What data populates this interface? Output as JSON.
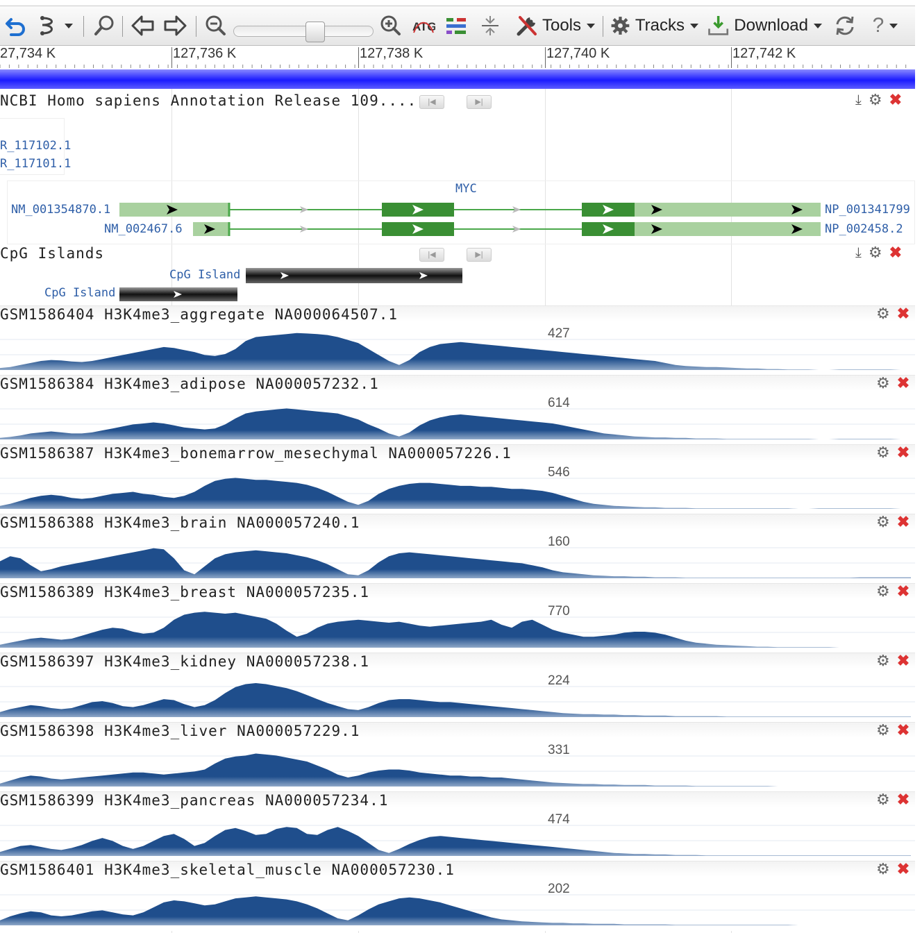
{
  "toolbar": {
    "tools_label": "Tools",
    "tracks_label": "Tracks",
    "download_label": "Download",
    "items": [
      {
        "icon": "undo-icon"
      },
      {
        "icon": "tracks-menu-icon"
      },
      {
        "icon": "find-icon"
      },
      {
        "icon": "pan-left-icon"
      },
      {
        "icon": "pan-right-icon"
      },
      {
        "icon": "zoom-out-icon"
      },
      {
        "icon": "zoom-in-icon"
      },
      {
        "icon": "sequence-view-icon"
      },
      {
        "icon": "color-key-icon"
      },
      {
        "icon": "collapse-icon"
      },
      {
        "icon": "tools-icon"
      },
      {
        "icon": "tracks-gear-icon"
      },
      {
        "icon": "download-icon"
      },
      {
        "icon": "reload-icon"
      },
      {
        "icon": "help-icon"
      }
    ],
    "zoom_slider_value": 0.55
  },
  "ruler": {
    "labels": [
      "27,734 K",
      "127,736 K",
      "127,738 K",
      "127,740 K",
      "127,742 K"
    ]
  },
  "annotation_track": {
    "title": "NCBI Homo sapiens Annotation Release 109....",
    "left_labels": [
      "R_117102.1",
      "R_117101.1"
    ],
    "gene_name": "MYC",
    "transcripts": [
      {
        "name": "NM_001354870.1",
        "protein": "NP_001341799"
      },
      {
        "name": "NM_002467.6",
        "protein": "NP_002458.2"
      }
    ]
  },
  "cpg_track": {
    "title": "CpG Islands",
    "features": [
      {
        "label": "CpG Island"
      },
      {
        "label": "CpG Island"
      }
    ]
  },
  "graph_tracks": [
    {
      "title": "GSM1586404 H3K4me3_aggregate NA000064507.1",
      "max": "427",
      "profile": [
        4,
        6,
        10,
        14,
        18,
        20,
        19,
        17,
        16,
        18,
        22,
        26,
        30,
        34,
        38,
        42,
        46,
        44,
        40,
        36,
        30,
        28,
        32,
        42,
        58,
        66,
        68,
        70,
        72,
        74,
        73,
        72,
        70,
        66,
        60,
        54,
        42,
        30,
        18,
        10,
        20,
        36,
        46,
        52,
        54,
        56,
        54,
        52,
        50,
        48,
        46,
        44,
        42,
        40,
        38,
        36,
        34,
        32,
        30,
        28,
        26,
        24,
        22,
        20,
        18,
        14,
        10,
        8,
        7,
        6,
        6,
        5,
        4,
        3,
        3,
        2,
        2,
        1,
        1,
        1,
        0,
        0,
        1,
        1,
        1,
        1,
        1,
        1,
        0,
        0
      ]
    },
    {
      "title": "GSM1586384 H3K4me3_adipose NA000057232.1",
      "max": "614",
      "profile": [
        3,
        5,
        8,
        12,
        14,
        16,
        14,
        12,
        12,
        14,
        18,
        22,
        26,
        30,
        32,
        34,
        32,
        28,
        24,
        22,
        20,
        22,
        30,
        42,
        52,
        56,
        58,
        60,
        62,
        60,
        58,
        56,
        54,
        52,
        46,
        40,
        30,
        22,
        12,
        6,
        14,
        28,
        38,
        44,
        48,
        50,
        48,
        46,
        44,
        42,
        40,
        38,
        36,
        34,
        32,
        28,
        24,
        20,
        16,
        12,
        10,
        8,
        6,
        5,
        4,
        4,
        3,
        3,
        2,
        2,
        2,
        1,
        1,
        1,
        1,
        1,
        1,
        1,
        1,
        1,
        0,
        0,
        1,
        1,
        1,
        1,
        1,
        1,
        0,
        0
      ]
    },
    {
      "title": "GSM1586387 H3K4me3_bonemarrow_mesechymal NA000057226.1",
      "max": "546",
      "profile": [
        6,
        10,
        16,
        22,
        26,
        28,
        26,
        22,
        20,
        22,
        26,
        30,
        32,
        34,
        30,
        28,
        24,
        22,
        26,
        34,
        46,
        56,
        60,
        62,
        60,
        58,
        58,
        56,
        54,
        52,
        48,
        42,
        34,
        24,
        14,
        8,
        16,
        30,
        40,
        46,
        50,
        52,
        52,
        50,
        48,
        46,
        46,
        44,
        44,
        42,
        40,
        40,
        38,
        36,
        32,
        26,
        20,
        14,
        10,
        8,
        6,
        5,
        4,
        3,
        3,
        2,
        2,
        2,
        1,
        1,
        1,
        1,
        1,
        1,
        1,
        1,
        1,
        1,
        0,
        0,
        1,
        1,
        1,
        1,
        1,
        1,
        1,
        1,
        0,
        0
      ]
    },
    {
      "title": "GSM1586388 H3K4me3_brain NA000057240.1",
      "max": "160",
      "profile": [
        34,
        44,
        40,
        26,
        14,
        18,
        24,
        28,
        32,
        36,
        40,
        44,
        48,
        52,
        56,
        60,
        58,
        40,
        16,
        8,
        24,
        40,
        48,
        52,
        54,
        56,
        54,
        52,
        50,
        46,
        42,
        36,
        28,
        18,
        8,
        6,
        16,
        32,
        44,
        50,
        52,
        50,
        48,
        46,
        44,
        42,
        40,
        38,
        36,
        34,
        32,
        30,
        26,
        22,
        16,
        12,
        10,
        8,
        6,
        5,
        4,
        4,
        3,
        3,
        2,
        2,
        2,
        1,
        1,
        1,
        1,
        1,
        1,
        1,
        1,
        1,
        1,
        1,
        1,
        1,
        1,
        1,
        1,
        1,
        2,
        2,
        2,
        2,
        2,
        2
      ]
    },
    {
      "title": "GSM1586389 H3K4me3_breast NA000057235.1",
      "max": "770",
      "profile": [
        6,
        10,
        14,
        18,
        20,
        18,
        16,
        18,
        24,
        30,
        36,
        40,
        38,
        32,
        28,
        30,
        40,
        56,
        66,
        70,
        72,
        70,
        68,
        70,
        66,
        62,
        58,
        48,
        34,
        22,
        28,
        40,
        48,
        52,
        54,
        56,
        54,
        52,
        50,
        52,
        48,
        44,
        42,
        44,
        46,
        48,
        50,
        52,
        56,
        46,
        40,
        52,
        56,
        46,
        36,
        30,
        26,
        22,
        22,
        24,
        26,
        30,
        32,
        32,
        30,
        26,
        20,
        14,
        10,
        8,
        6,
        5,
        4,
        3,
        2,
        2,
        1,
        1,
        1,
        1,
        1,
        1,
        0,
        0,
        0,
        0,
        0,
        0,
        0,
        0
      ]
    },
    {
      "title": "GSM1586397 H3K4me3_kidney NA000057238.1",
      "max": "224",
      "profile": [
        10,
        16,
        20,
        24,
        22,
        18,
        16,
        18,
        24,
        30,
        32,
        28,
        22,
        20,
        24,
        30,
        36,
        34,
        26,
        20,
        24,
        34,
        48,
        60,
        66,
        68,
        66,
        62,
        58,
        52,
        44,
        36,
        28,
        22,
        16,
        14,
        20,
        28,
        34,
        36,
        36,
        34,
        32,
        30,
        30,
        28,
        26,
        24,
        22,
        20,
        18,
        16,
        14,
        12,
        10,
        8,
        7,
        6,
        6,
        5,
        5,
        4,
        4,
        3,
        3,
        3,
        2,
        2,
        2,
        2,
        2,
        1,
        1,
        1,
        1,
        1,
        1,
        1,
        1,
        1,
        1,
        1,
        1,
        1,
        1,
        1,
        1,
        1,
        1,
        1
      ]
    },
    {
      "title": "GSM1586398 H3K4me3_liver NA000057229.1",
      "max": "331",
      "profile": [
        6,
        12,
        18,
        22,
        20,
        16,
        14,
        16,
        18,
        20,
        22,
        24,
        26,
        28,
        28,
        26,
        24,
        26,
        28,
        30,
        34,
        46,
        56,
        60,
        62,
        66,
        64,
        62,
        58,
        54,
        50,
        42,
        34,
        24,
        18,
        22,
        28,
        32,
        34,
        34,
        32,
        28,
        26,
        24,
        22,
        22,
        20,
        20,
        18,
        18,
        16,
        14,
        12,
        10,
        8,
        7,
        6,
        5,
        5,
        4,
        4,
        3,
        3,
        3,
        2,
        2,
        2,
        2,
        1,
        1,
        1,
        1,
        1,
        1,
        1,
        1,
        0,
        0,
        0,
        0,
        0,
        0,
        0,
        0,
        0,
        0,
        0,
        0,
        0,
        0
      ]
    },
    {
      "title": "GSM1586399 H3K4me3_pancreas NA000057234.1",
      "max": "474",
      "profile": [
        8,
        14,
        20,
        22,
        18,
        14,
        12,
        16,
        22,
        30,
        36,
        30,
        20,
        14,
        20,
        30,
        40,
        44,
        34,
        20,
        26,
        40,
        52,
        56,
        50,
        42,
        44,
        54,
        58,
        56,
        44,
        42,
        52,
        58,
        50,
        40,
        26,
        12,
        6,
        14,
        24,
        32,
        38,
        40,
        38,
        36,
        34,
        32,
        30,
        28,
        26,
        24,
        22,
        20,
        18,
        16,
        14,
        12,
        10,
        8,
        6,
        5,
        4,
        4,
        3,
        3,
        2,
        2,
        2,
        1,
        1,
        1,
        1,
        1,
        1,
        1,
        1,
        1,
        1,
        1,
        1,
        1,
        1,
        1,
        1,
        1,
        1,
        1,
        1,
        1
      ]
    },
    {
      "title": "GSM1586401 H3K4me3_skeletal_muscle NA000057230.1",
      "max": "202",
      "profile": [
        10,
        18,
        24,
        28,
        26,
        20,
        18,
        20,
        24,
        28,
        30,
        26,
        22,
        20,
        26,
        36,
        46,
        50,
        48,
        44,
        40,
        42,
        48,
        54,
        56,
        58,
        56,
        54,
        52,
        48,
        42,
        34,
        24,
        14,
        10,
        20,
        32,
        42,
        48,
        54,
        56,
        54,
        50,
        46,
        40,
        34,
        28,
        22,
        16,
        12,
        10,
        8,
        7,
        6,
        5,
        5,
        4,
        4,
        3,
        3,
        3,
        2,
        2,
        2,
        2,
        2,
        1,
        1,
        1,
        1,
        1,
        1,
        1,
        1,
        1,
        1,
        1,
        1,
        0,
        0,
        0,
        0,
        0,
        0,
        0,
        0,
        0,
        0,
        0,
        0
      ]
    }
  ],
  "colors": {
    "graph_fill": "#1f4e8c",
    "graph_fill_light": "#8fa8c8",
    "gene_dark": "#3a8f34",
    "gene_light": "#a9d19f",
    "intron": "#4aa84a",
    "label_blue": "#2f5fa8",
    "cpg_dark": "#222222"
  }
}
